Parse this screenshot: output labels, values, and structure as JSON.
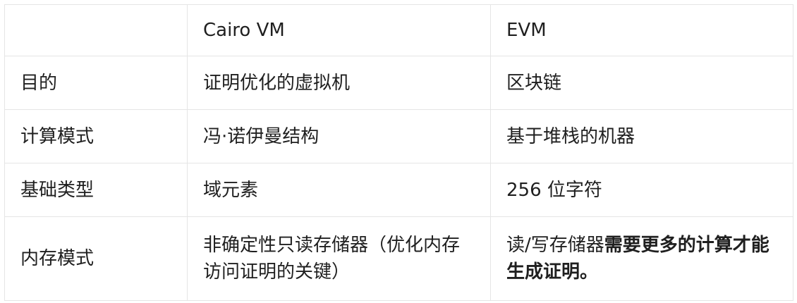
{
  "table": {
    "headers": [
      "",
      "Cairo VM",
      "EVM"
    ],
    "rows": [
      {
        "label": "目的",
        "cairo": "证明优化的虚拟机",
        "evm": "区块链"
      },
      {
        "label": "计算模式",
        "cairo": "冯·诺伊曼结构",
        "evm": "基于堆栈的机器"
      },
      {
        "label": "基础类型",
        "cairo": "域元素",
        "evm": "256 位字符"
      },
      {
        "label": "内存模式",
        "cairo": "非确定性只读存储器（优化内存访问证明的关键）",
        "evm_plain": "读/写存储器",
        "evm_bold": "需要更多的计算才能生成证明。"
      }
    ]
  }
}
